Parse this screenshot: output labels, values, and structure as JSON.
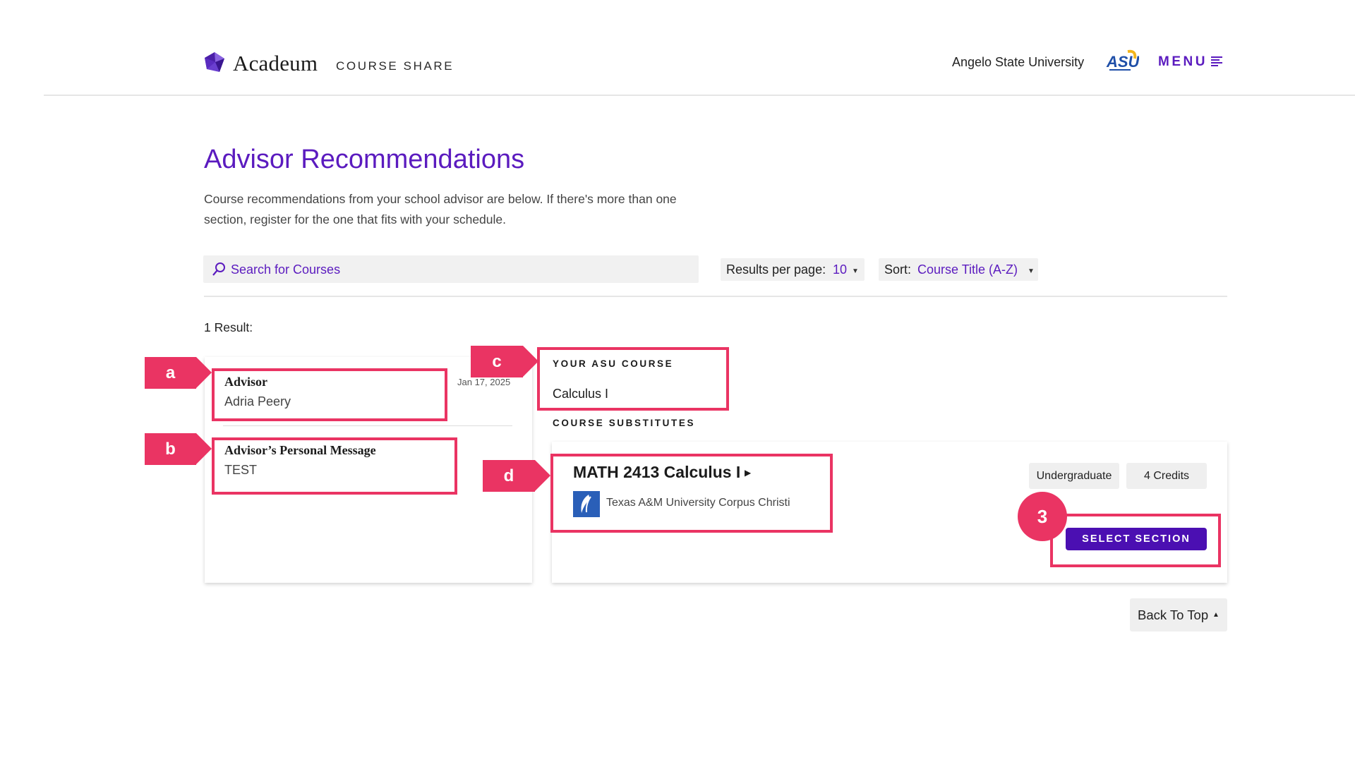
{
  "header": {
    "brand": "Acadeum",
    "brand_sub": "COURSE SHARE",
    "university": "Angelo State University",
    "menu_label": "MENU",
    "accent_color": "#5b1bbf"
  },
  "page": {
    "title": "Advisor Recommendations",
    "description": "Course recommendations from your school advisor are below. If there's more than one section, register for the one that fits with your schedule."
  },
  "controls": {
    "search_placeholder": "Search for Courses",
    "results_per_page_label": "Results per page:",
    "results_per_page_value": "10",
    "sort_label": "Sort:",
    "sort_value": "Course Title (A-Z)"
  },
  "results": {
    "count_text": "1 Result:"
  },
  "advisor": {
    "label": "Advisor",
    "name": "Adria Peery",
    "date": "Jan 17, 2025",
    "message_label": "Advisor’s Personal Message",
    "message": "TEST"
  },
  "course": {
    "your_course_label": "YOUR ASU COURSE",
    "your_course_value": "Calculus I",
    "substitutes_label": "COURSE SUBSTITUTES",
    "title": "MATH 2413 Calculus I",
    "school": "Texas A&M University Corpus Christi",
    "level": "Undergraduate",
    "credits": "4 Credits",
    "select_label": "SELECT SECTION"
  },
  "footer": {
    "back_to_top": "Back To Top"
  },
  "annotations": {
    "a": "a",
    "b": "b",
    "c": "c",
    "d": "d",
    "step": "3",
    "color": "#ea3463"
  },
  "icons": {
    "logo": "gem-icon",
    "menu": "hamburger-icon",
    "search": "search-icon",
    "caret": "caret-down-icon",
    "course_caret": "caret-right-icon",
    "back_top_caret": "caret-up-icon"
  }
}
